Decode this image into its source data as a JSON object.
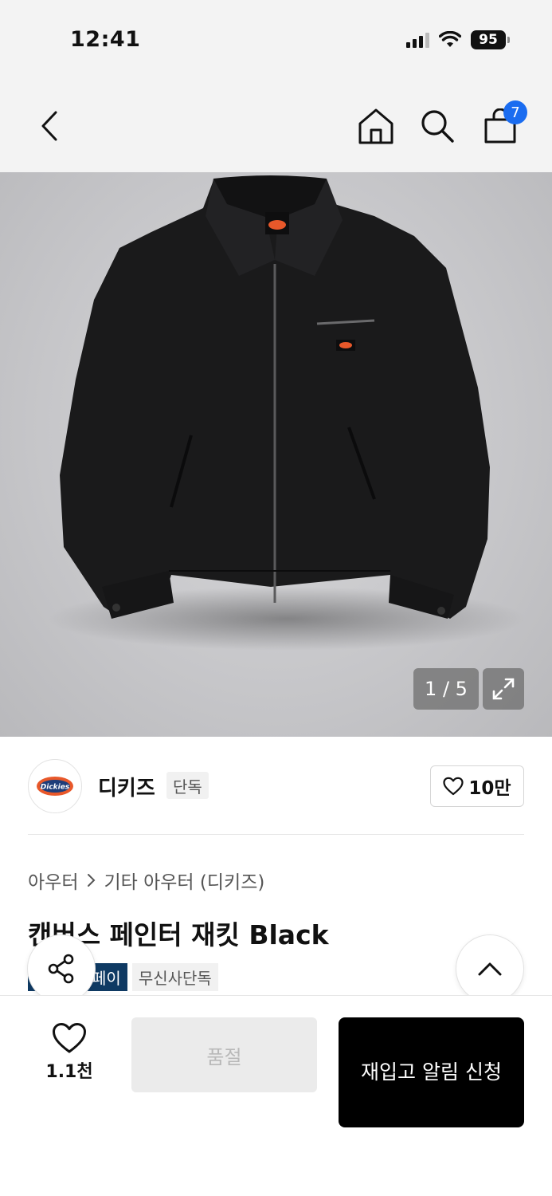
{
  "status_bar": {
    "time": "12:41",
    "battery": "95"
  },
  "nav": {
    "cart_count": "7"
  },
  "gallery": {
    "counter": "1 / 5"
  },
  "brand": {
    "name": "디키즈",
    "badge": "단독",
    "likes": "10만",
    "logo_text": "Dickies"
  },
  "breadcrumb": {
    "category": "아우터",
    "subcategory": "기타 아우터 (디키즈)"
  },
  "product": {
    "title": "캔버스 페인터 재킷 Black",
    "tags": [
      "페이",
      "무신사단독"
    ]
  },
  "bottom_bar": {
    "wish_count": "1.1천",
    "soldout_label": "품절",
    "restock_label": "재입고 알림 신청"
  },
  "colors": {
    "accent_blue": "#1a6cf0",
    "tag_navy": "#0f3a63",
    "brand_orange": "#e8582a"
  }
}
